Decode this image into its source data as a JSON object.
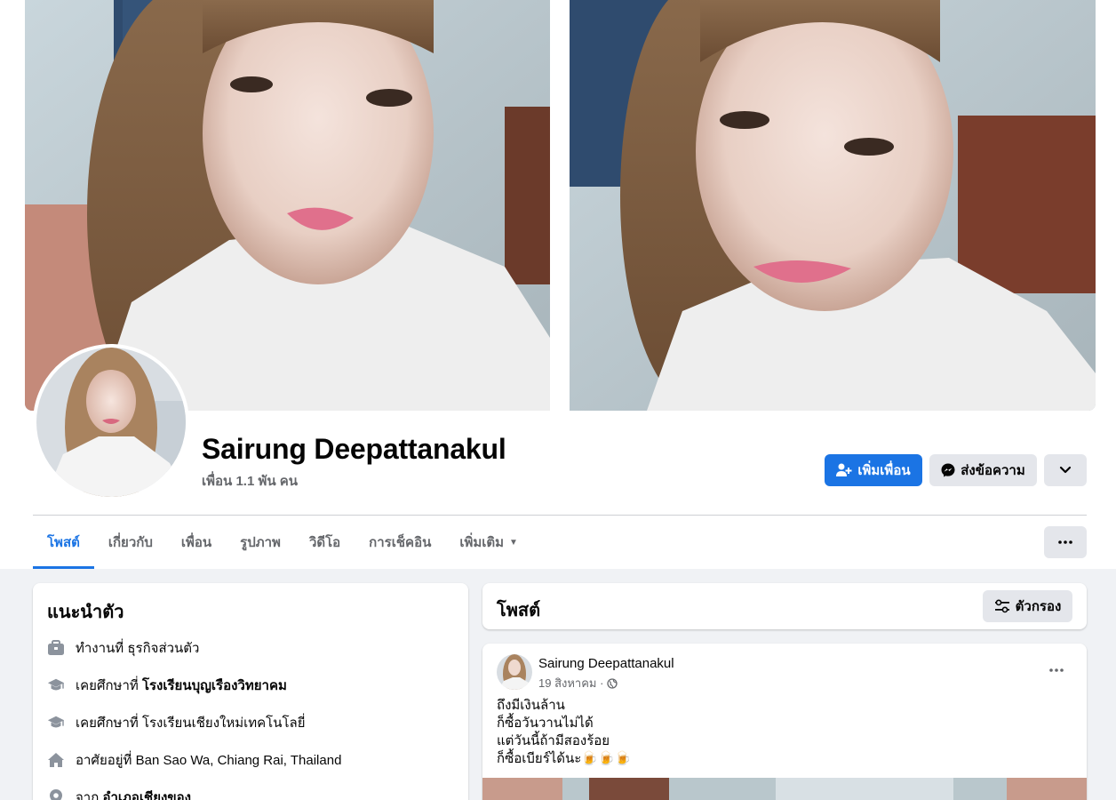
{
  "profile": {
    "name": "Sairung Deepattanakul",
    "friends": "เพื่อน 1.1 พัน คน"
  },
  "actions": {
    "add_friend": "เพิ่มเพื่อน",
    "message": "ส่งข้อความ"
  },
  "tabs": [
    {
      "label": "โพสต์",
      "active": true
    },
    {
      "label": "เกี่ยวกับ"
    },
    {
      "label": "เพื่อน"
    },
    {
      "label": "รูปภาพ"
    },
    {
      "label": "วิดีโอ"
    },
    {
      "label": "การเช็คอิน"
    },
    {
      "label": "เพิ่มเติม"
    }
  ],
  "intro": {
    "title": "แนะนำตัว",
    "items": [
      {
        "icon": "briefcase-icon",
        "prefix": "ทำงานที่ ",
        "bold": "",
        "text": "ธุรกิจส่วนตัว"
      },
      {
        "icon": "graduation-cap-icon",
        "prefix": "เคยศึกษาที่ ",
        "bold": "โรงเรียนบุญเรืองวิทยาคม",
        "text": ""
      },
      {
        "icon": "graduation-cap-icon",
        "prefix": "เคยศึกษาที่ ",
        "bold": "",
        "text": "โรงเรียนเชียงใหม่เทคโนโลยี่"
      },
      {
        "icon": "home-icon",
        "prefix": "อาศัยอยู่ที่ ",
        "bold": "",
        "text": "Ban Sao Wa, Chiang Rai, Thailand"
      },
      {
        "icon": "location-pin-icon",
        "prefix": "จาก ",
        "bold": "อำเภอเชียงของ",
        "text": ""
      }
    ]
  },
  "posts_header": {
    "title": "โพสต์",
    "filter_label": "ตัวกรอง"
  },
  "post": {
    "author": "Sairung Deepattanakul",
    "date": "19 สิงหาคม ·",
    "lines": [
      "ถึงมีเงินล้าน",
      "ก็ซื้อวันวานไม่ได้",
      "แต่วันนี้ถ้ามีสองร้อย",
      "ก็ซื้อเบียร์ได้นะ🍺🍺🍺"
    ]
  },
  "colors": {
    "accent": "#1b74e4",
    "background": "#f0f2f5",
    "secondary_text": "#65676b",
    "button_gray": "#e4e6eb"
  }
}
